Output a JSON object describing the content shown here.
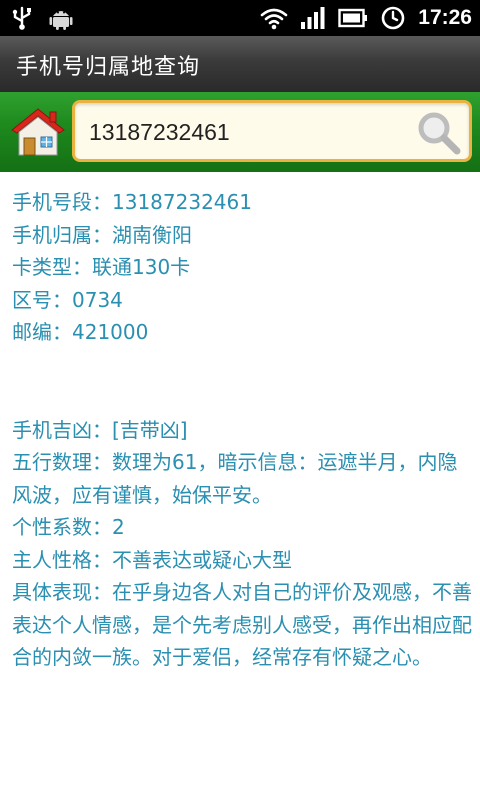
{
  "status_bar": {
    "time": "17:26",
    "left_icons": [
      "usb-icon",
      "android-debug-icon"
    ],
    "right_icons": [
      "wifi-icon",
      "signal-icon",
      "battery-icon",
      "alarm-icon"
    ]
  },
  "title_bar": {
    "title": "手机号归属地查询"
  },
  "search": {
    "value": "13187232461",
    "home_icon": "home-icon",
    "search_icon": "search-icon"
  },
  "info": {
    "segment": "手机号段：13187232461",
    "location": "手机归属：湖南衡阳",
    "card_type": "卡类型：联通130卡",
    "area_code": "区号：0734",
    "postcode": "邮编：421000"
  },
  "fortune": {
    "luck": "手机吉凶：[吉带凶]",
    "wuxing": "五行数理：数理为61，暗示信息：运遮半月，内隐风波，应有谨慎，始保平安。",
    "personality_index": "个性系数：2",
    "character": "主人性格：不善表达或疑心大型",
    "behavior": "具体表现：在乎身边各人对自己的评价及观感，不善表达个人情感，是个先考虑别人感受，再作出相应配合的内敛一族。对于爱侣，经常存有怀疑之心。"
  },
  "colors": {
    "status_bar_bg": "#000000",
    "title_bar_bg": "#3a3a3a",
    "search_bar_bg": "#1e8a1e",
    "search_box_border": "#e9b341",
    "content_text": "#2a8fb0"
  }
}
